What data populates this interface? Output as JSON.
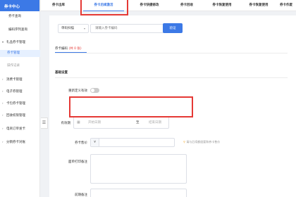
{
  "sidebar": {
    "title": "券卡中心",
    "items": [
      {
        "label": "券卡查询"
      },
      {
        "label": "编码序列查询"
      },
      {
        "label": "礼品券卡管理"
      },
      {
        "label": "券卡管理"
      },
      {
        "label": "操作记录"
      },
      {
        "label": "消费卡管理"
      },
      {
        "label": "电子券管理"
      },
      {
        "label": "卡包券卡管理"
      },
      {
        "label": "回收权限管理"
      },
      {
        "label": "电商订单发卡"
      },
      {
        "label": "分销券卡对账"
      }
    ],
    "toggle_glyph": "☰"
  },
  "tabs": [
    "券卡出库",
    "券卡后续激活",
    "券卡快捷修改",
    "券卡回收",
    "券卡恢复使用",
    "券卡恢复使用",
    "券卡作废"
  ],
  "search": {
    "scan_select": "单码扫描",
    "code_placeholder": "请输入券卡编码",
    "verify_label": "验证"
  },
  "coupon_code_section": {
    "label": "券卡编码",
    "count": "(共 0 张)"
  },
  "basic_settings": {
    "title": "基础设置",
    "reset_validity_label": "重新定义有效",
    "validity_label": "有效期",
    "start_placeholder": "开始日期",
    "range_separator": "至",
    "end_placeholder": "结束日期",
    "price_label": "券卡售价",
    "currency": "¥",
    "price_hint": "请与后续额度要和券卡售价",
    "print_note_label": "面单打印备注",
    "remark_label": "前期备注"
  },
  "colors": {
    "accent": "#3c79e6",
    "highlight": "#e53935"
  }
}
